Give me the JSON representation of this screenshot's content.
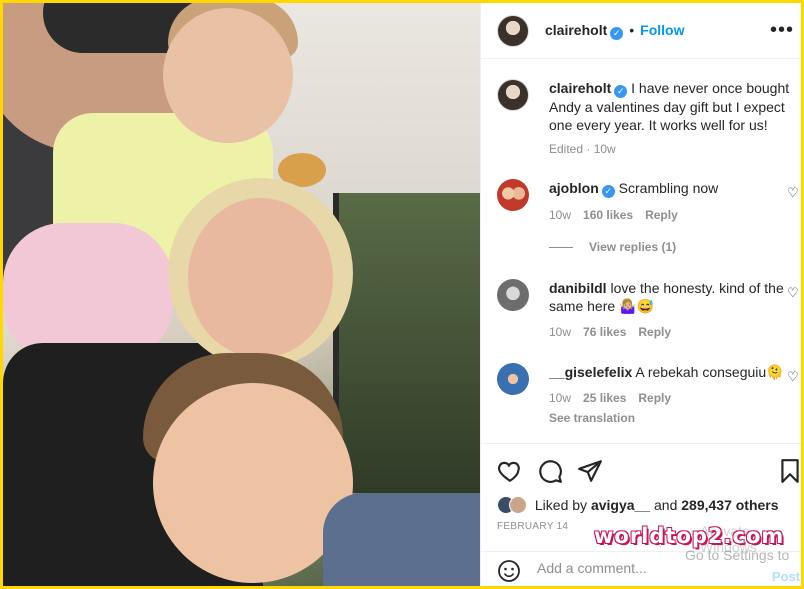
{
  "post": {
    "author": "claireholt",
    "follow_label": "Follow",
    "more_icon": "more-horizontal-icon",
    "caption": "I have never once bought Andy a valentines day gift but I expect one every year. It works well for us!",
    "edited": "Edited · 10w"
  },
  "comments": [
    {
      "user": "ajoblon",
      "verified": true,
      "text": "Scrambling now",
      "time": "10w",
      "likes": "160 likes",
      "reply": "Reply"
    },
    {
      "user": "danibildl",
      "verified": false,
      "text": "love the honesty. kind of the same here 🤷🏼‍♀️😅",
      "time": "10w",
      "likes": "76 likes",
      "reply": "Reply"
    },
    {
      "user": "__giselefelix",
      "verified": false,
      "text": "A rebekah conseguiu🫠",
      "time": "10w",
      "likes": "25 likes",
      "reply": "Reply",
      "translation": "See translation"
    }
  ],
  "view_replies": "View replies (1)",
  "likes": {
    "prefix": "Liked by",
    "user": "avigya__",
    "middle": "and",
    "count": "289,437 others"
  },
  "date": "FEBRUARY 14",
  "add_comment": {
    "placeholder": "Add a comment...",
    "post_label": "Post"
  },
  "overlay": {
    "watermark": "worldtop2.com",
    "activate_line1": "Activate Windows",
    "activate_line2": "Go to Settings to"
  },
  "colors": {
    "accent": "#0095f6",
    "border": "#ffd800",
    "watermark_outline": "#c2185b"
  }
}
